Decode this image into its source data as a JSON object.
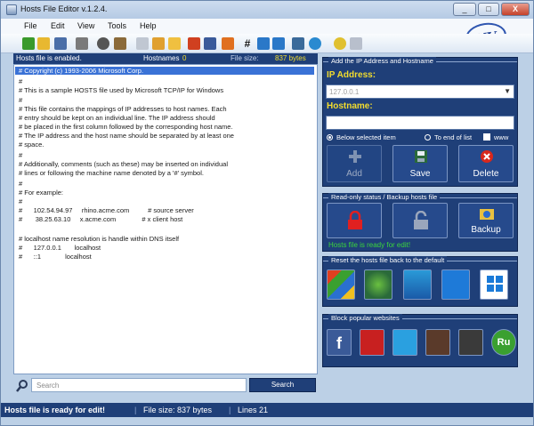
{
  "window": {
    "title": "Hosts File Editor v.1.2.4.",
    "minimize": "_",
    "maximize": "□",
    "close": "X",
    "logo": "NV"
  },
  "menu": [
    "File",
    "Edit",
    "View",
    "Tools",
    "Help"
  ],
  "toolbar_icons": [
    "new-icon",
    "open-icon",
    "save-icon",
    "print-icon",
    "find-icon",
    "replace-icon",
    "settings-icon",
    "view-icon",
    "folder-icon",
    "copy-icon",
    "paste-icon",
    "export-icon",
    "hash-icon",
    "move-up-icon",
    "move-down-icon",
    "network-icon",
    "globe-icon",
    "help-icon",
    "about-icon"
  ],
  "status_strip": {
    "enabled_text": "Hosts file is enabled.",
    "hostnames_label": "Hostnames",
    "hostnames_value": "0",
    "filesize_label": "File size:",
    "filesize_value": "837 bytes"
  },
  "editor_lines": [
    "# Copyright (c) 1993-2006 Microsoft Corp.",
    "#",
    "# This is a sample HOSTS file used by Microsoft TCP/IP for Windows",
    "#",
    "# This file contains the mappings of IP addresses to host names. Each",
    "# entry should be kept on an individual line. The IP address should",
    "# be placed in the first column followed by the corresponding host name.",
    "# The IP address and the host name should be separated by at least one",
    "# space.",
    "#",
    "# Additionally, comments (such as these) may be inserted on individual",
    "# lines or following the machine name denoted by a '#' symbol.",
    "#",
    "# For example:",
    "#",
    "#      102.54.94.97     rhino.acme.com          # source server",
    "#       38.25.63.10     x.acme.com              # x client host",
    "",
    "# localhost name resolution is handle within DNS itself",
    "#      127.0.0.1       localhost",
    "#      ::1             localhost"
  ],
  "search": {
    "placeholder": "Search",
    "button": "Search"
  },
  "add_panel": {
    "caption": "Add the IP Address and Hostname",
    "ip_label": "IP Address:",
    "ip_value": "127.0.0.1",
    "hostname_label": "Hostname:",
    "hostname_value": "",
    "radio_below": "Below selected item",
    "radio_end": "To end of list",
    "www_label": "www",
    "add_button": "Add",
    "save_button": "Save",
    "delete_button": "Delete"
  },
  "readonly_panel": {
    "caption": "Read-only status / Backup hosts file",
    "backup_button": "Backup",
    "status": "Hosts file is ready for edit!"
  },
  "reset_panel": {
    "caption": "Reset the hosts file back to the default",
    "buttons": [
      "Windows XP",
      "Windows Vista",
      "Windows 7",
      "Windows 8",
      "Windows 10"
    ]
  },
  "block_panel": {
    "caption": "Block popular websites",
    "sites": [
      "Facebook",
      "YouTube",
      "Twitter",
      "Instagram",
      "MyTube",
      "Ru"
    ]
  },
  "statusbar": {
    "message": "Hosts file is ready for edit!",
    "sep1": "|",
    "filesize": "File size:  837 bytes",
    "sep2": "|",
    "lines": "Lines 21"
  },
  "colors": {
    "panel": "#1f3f78",
    "accent_yellow": "#f2dc2e",
    "ready_green": "#3bd63b",
    "selection": "#3a72d6"
  }
}
